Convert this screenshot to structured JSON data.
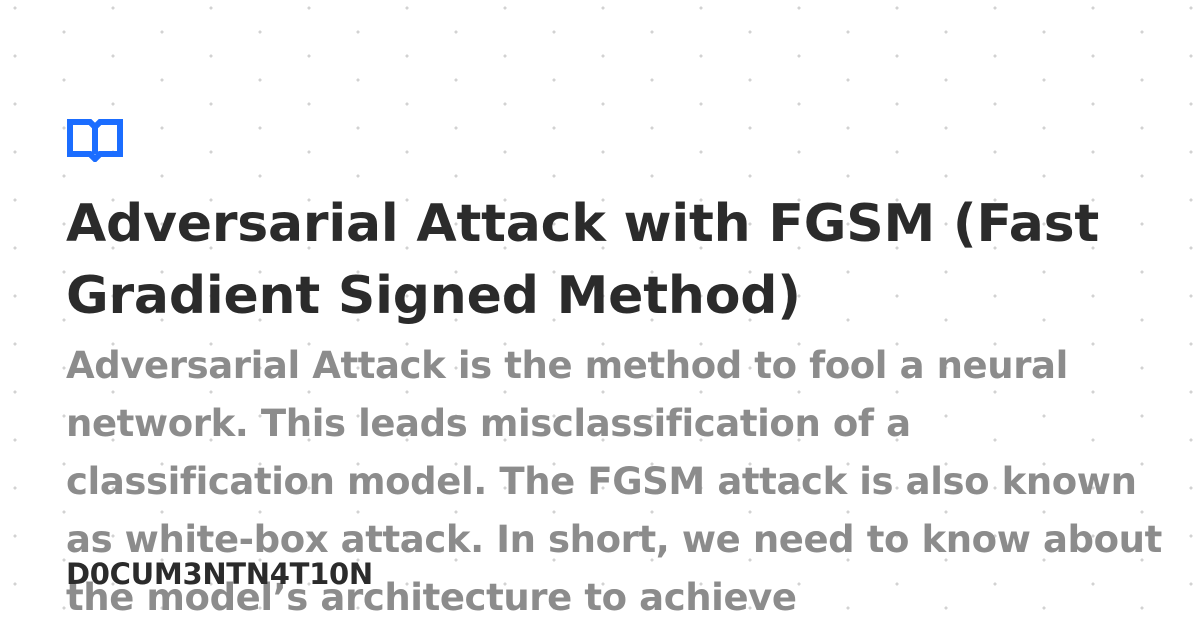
{
  "logo": {
    "icon": "book-icon",
    "color": "#1b6dff"
  },
  "title": "Adversarial Attack with FGSM (Fast Gradient Signed Method)",
  "description": "Adversarial Attack is the method to fool a neural network. This leads misclassification of a classification model. The FGSM attack is also known as white-box attack. In short, we need to know about the model’s architecture to achieve",
  "site_name": "D0CUM3NTN4T10N",
  "colors": {
    "title": "#2b2b2b",
    "description": "#8c8c8c",
    "dots": "#d2d2d2",
    "background": "#ffffff"
  }
}
